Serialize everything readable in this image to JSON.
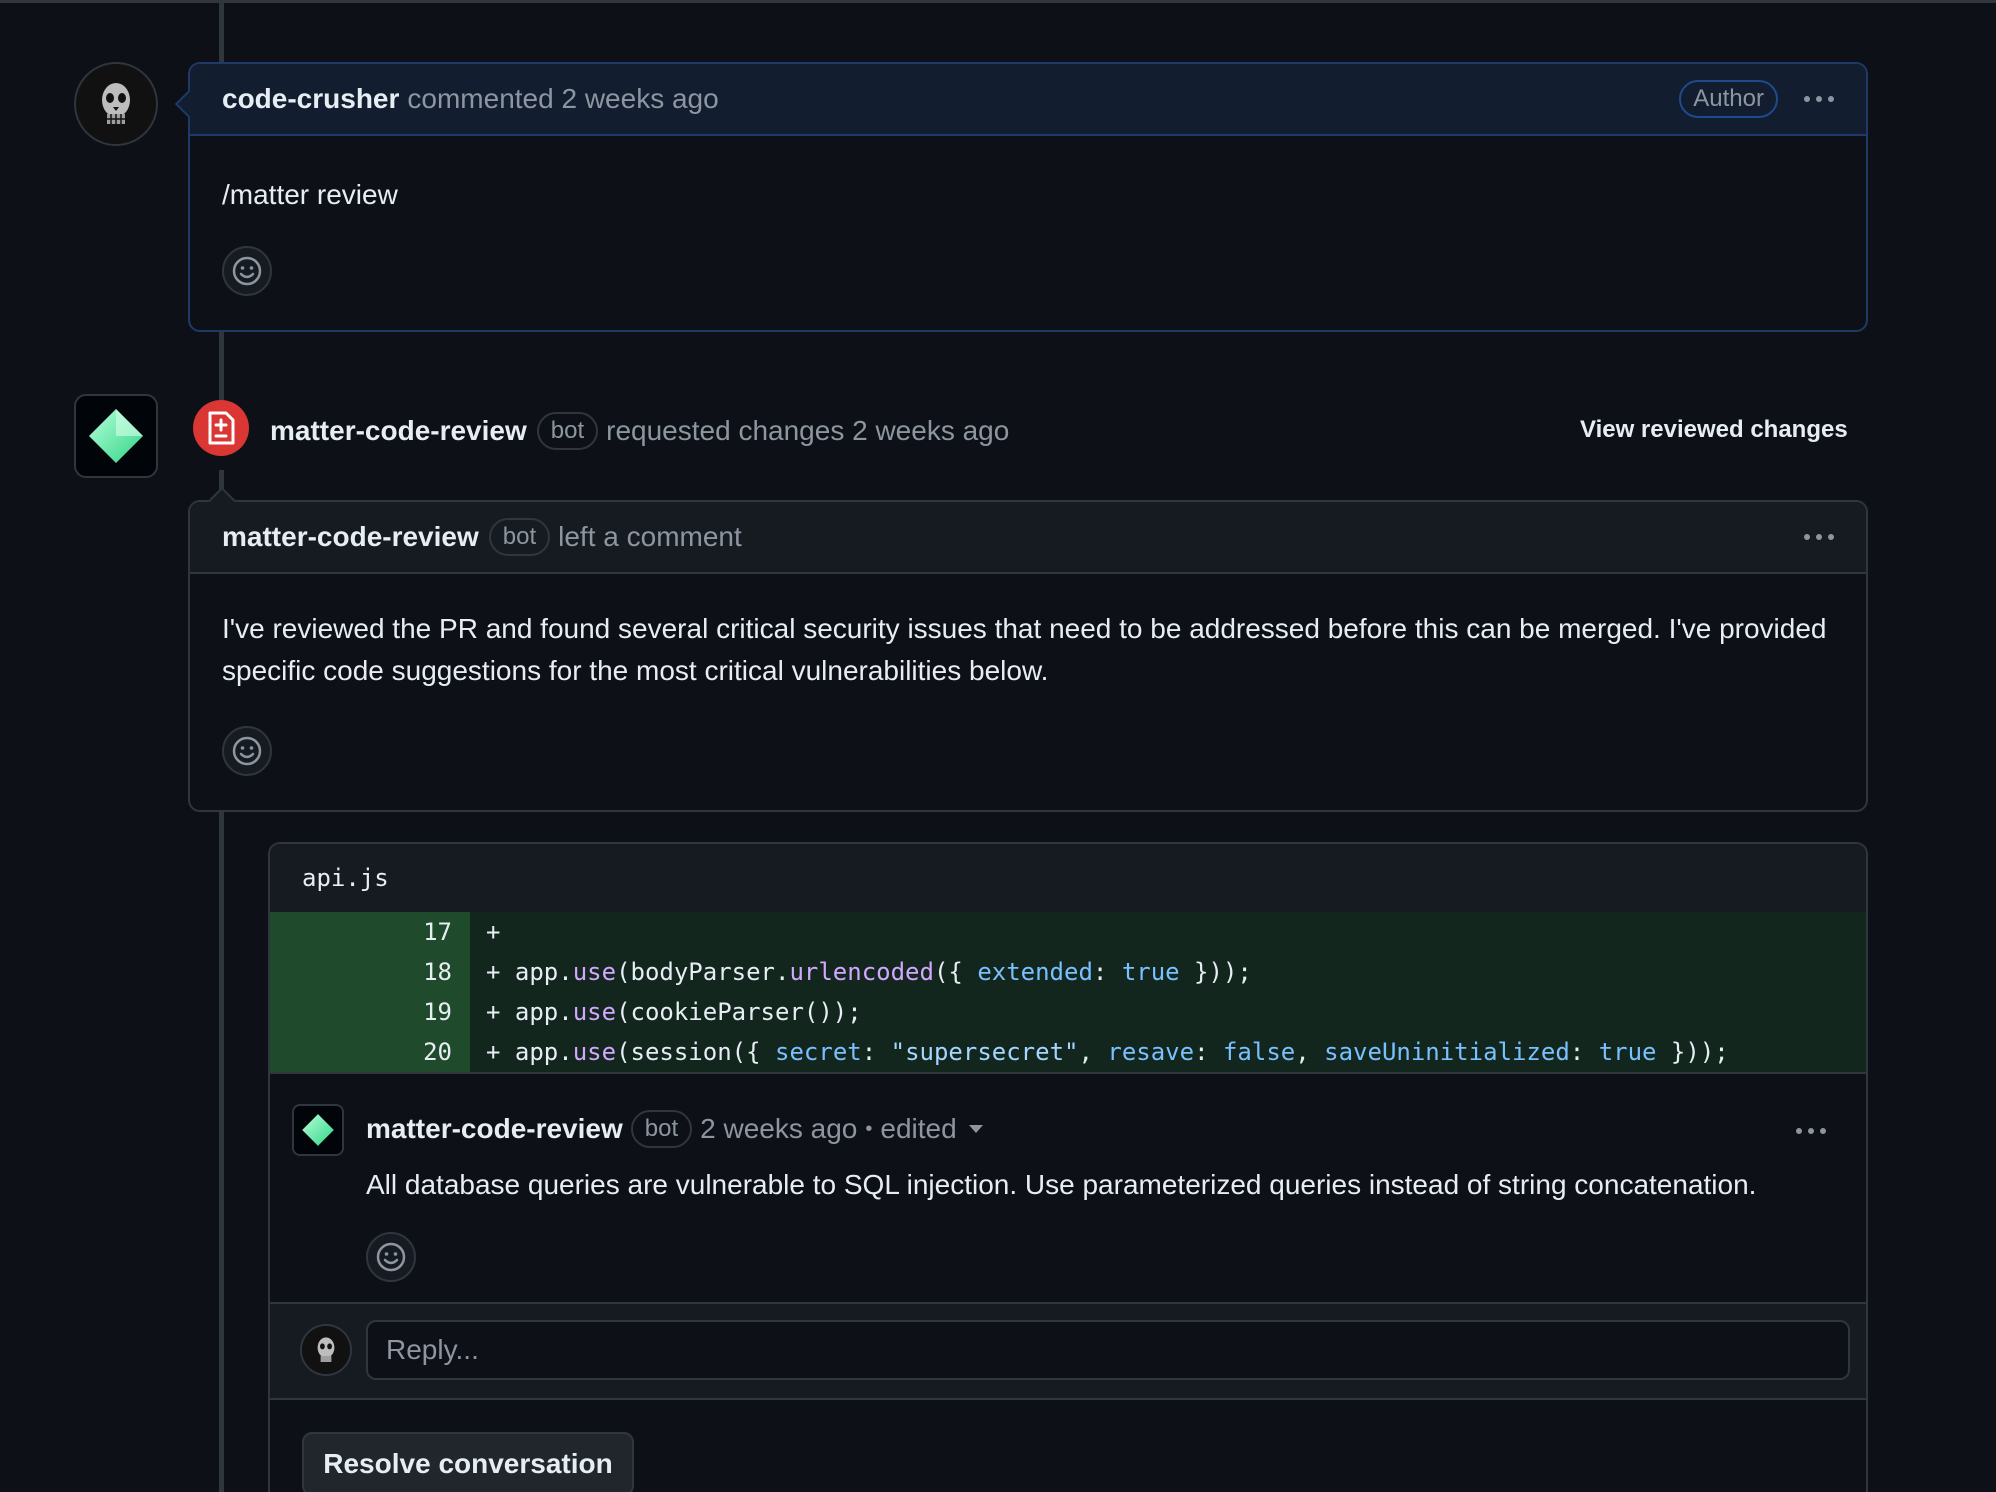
{
  "comment1": {
    "author": "code-crusher",
    "action": "commented 2 weeks ago",
    "badge": "Author",
    "body": "/matter review"
  },
  "review": {
    "author": "matter-code-review",
    "bot_badge": "bot",
    "action": "requested changes 2 weeks ago",
    "view_changes_label": "View reviewed changes"
  },
  "review_comment": {
    "author": "matter-code-review",
    "bot_badge": "bot",
    "action": "left a comment",
    "body": "I've reviewed the PR and found several critical security issues that need to be addressed before this can be merged. I've provided specific code suggestions for the most critical vulnerabilities below."
  },
  "thread": {
    "file_name": "api.js",
    "lines": [
      {
        "number": "17",
        "code": "+"
      },
      {
        "number": "18",
        "code": "+ app.use(bodyParser.urlencoded({ extended: true }));"
      },
      {
        "number": "19",
        "code": "+ app.use(cookieParser());"
      },
      {
        "number": "20",
        "code": "+ app.use(session({ secret: \"supersecret\", resave: false, saveUninitialized: true }));"
      }
    ],
    "comment": {
      "author": "matter-code-review",
      "bot_badge": "bot",
      "time": "2 weeks ago",
      "separator": "•",
      "edited": "edited",
      "body": "All database queries are vulnerable to SQL injection. Use parameterized queries instead of string concatenation."
    },
    "reply_placeholder": "Reply...",
    "resolve_label": "Resolve conversation"
  },
  "colors": {
    "background": "#0d1117",
    "border": "#30363d",
    "author_border": "#1f3a68",
    "changes_requested": "#da3633",
    "added_line_bg": "#12261e",
    "bot_logo": "#4ee6a0"
  },
  "icons": [
    "skull-avatar-icon",
    "diamond-bot-logo-icon",
    "file-diff-icon",
    "smiley-icon",
    "kebab-icon",
    "caret-down-icon"
  ]
}
